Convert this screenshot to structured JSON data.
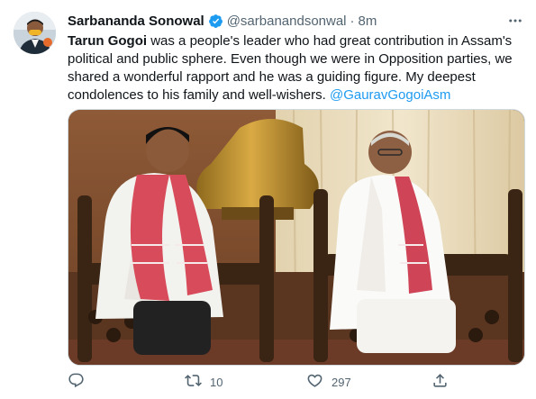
{
  "tweet": {
    "author_name": "Sarbananda Sonowal",
    "handle": "@sarbanandsonwal",
    "separator": "·",
    "time": "8m",
    "text_lines": [
      [
        "Tarun Gogoi",
        " was a people's leader who had great contribution in Assam's"
      ],
      [
        "political and public sphere. Even though we were in Opposition parties, we"
      ],
      [
        "shared a wonderful rapport and he was a guiding figure. My deepest"
      ],
      [
        "condolences to his family and well-wishers. ",
        "@GauravGogoiAsm"
      ]
    ],
    "icons": {
      "verified": "verified-badge-icon",
      "more": "more-options-icon",
      "reply": "reply-icon",
      "retweet": "retweet-icon",
      "like": "like-icon",
      "share": "share-icon"
    },
    "counts": {
      "reply": "",
      "retweet": "10",
      "like": "297"
    }
  },
  "colors": {
    "accent": "#1d9bf0",
    "text": "#0f1419",
    "secondary": "#536471"
  }
}
